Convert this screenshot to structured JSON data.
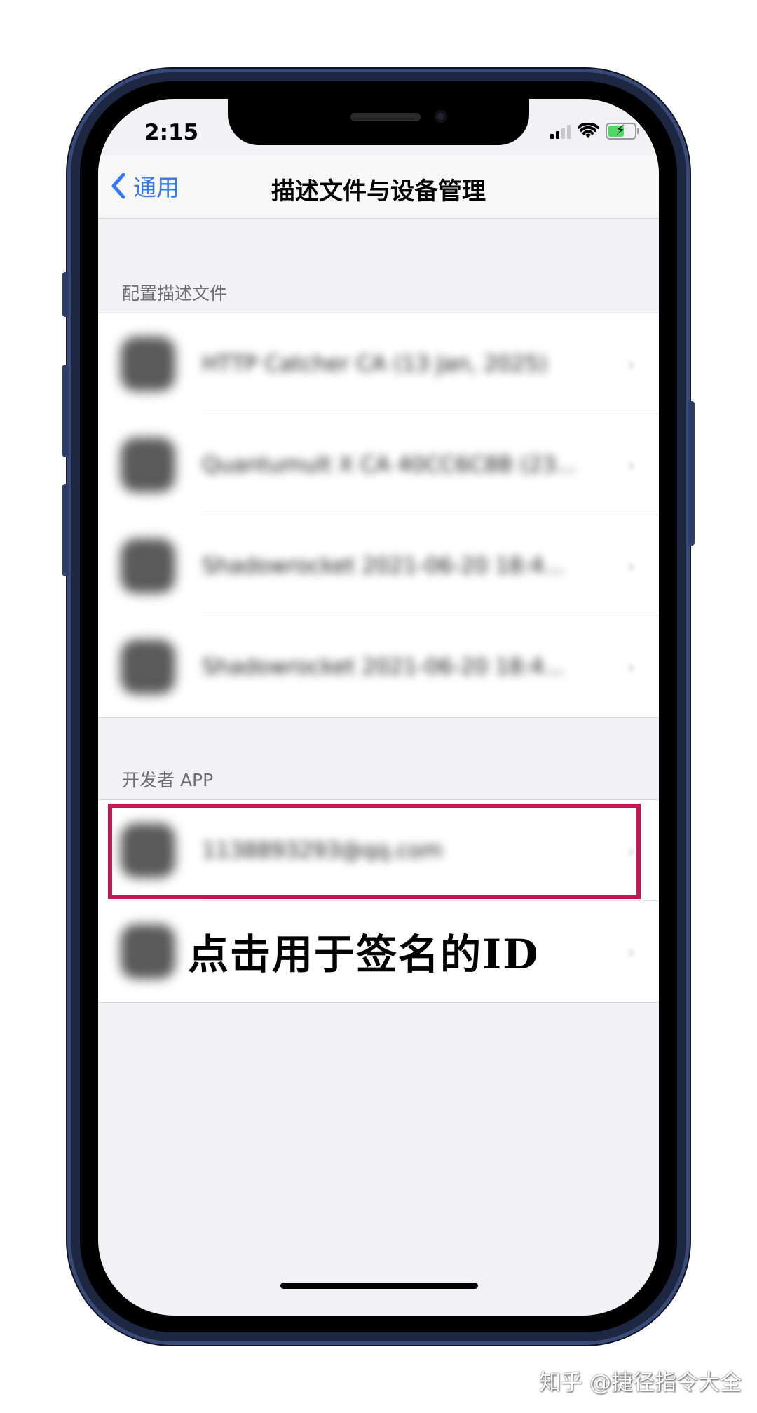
{
  "status_bar": {
    "time": "2:15"
  },
  "navbar": {
    "back_label": "通用",
    "title": "描述文件与设备管理"
  },
  "sections": {
    "profiles": {
      "header": "配置描述文件",
      "rows": [
        {
          "label": "HTTP Catcher CA (13 Jan, 2025)"
        },
        {
          "label": "Quantumult X CA 40CC6C8B (23..."
        },
        {
          "label": "Shadowrocket 2021-06-20 18:4..."
        },
        {
          "label": "Shadowrocket 2021-06-20 18:4..."
        }
      ]
    },
    "developer_app": {
      "header": "开发者 APP",
      "rows": [
        {
          "label": "1138893293@qq.com"
        },
        {
          "label": ""
        }
      ]
    }
  },
  "annotation": {
    "caption": "点击用于签名的ID",
    "highlight_color": "#c0184f"
  },
  "watermark": "知乎 @捷径指令大全",
  "colors": {
    "accent": "#3478f6",
    "background": "#f2f2f6",
    "frame": "#1d2742"
  },
  "icons": [
    "back-chevron-icon",
    "signal-icon",
    "wifi-icon",
    "battery-charging-icon",
    "chevron-right-icon"
  ]
}
